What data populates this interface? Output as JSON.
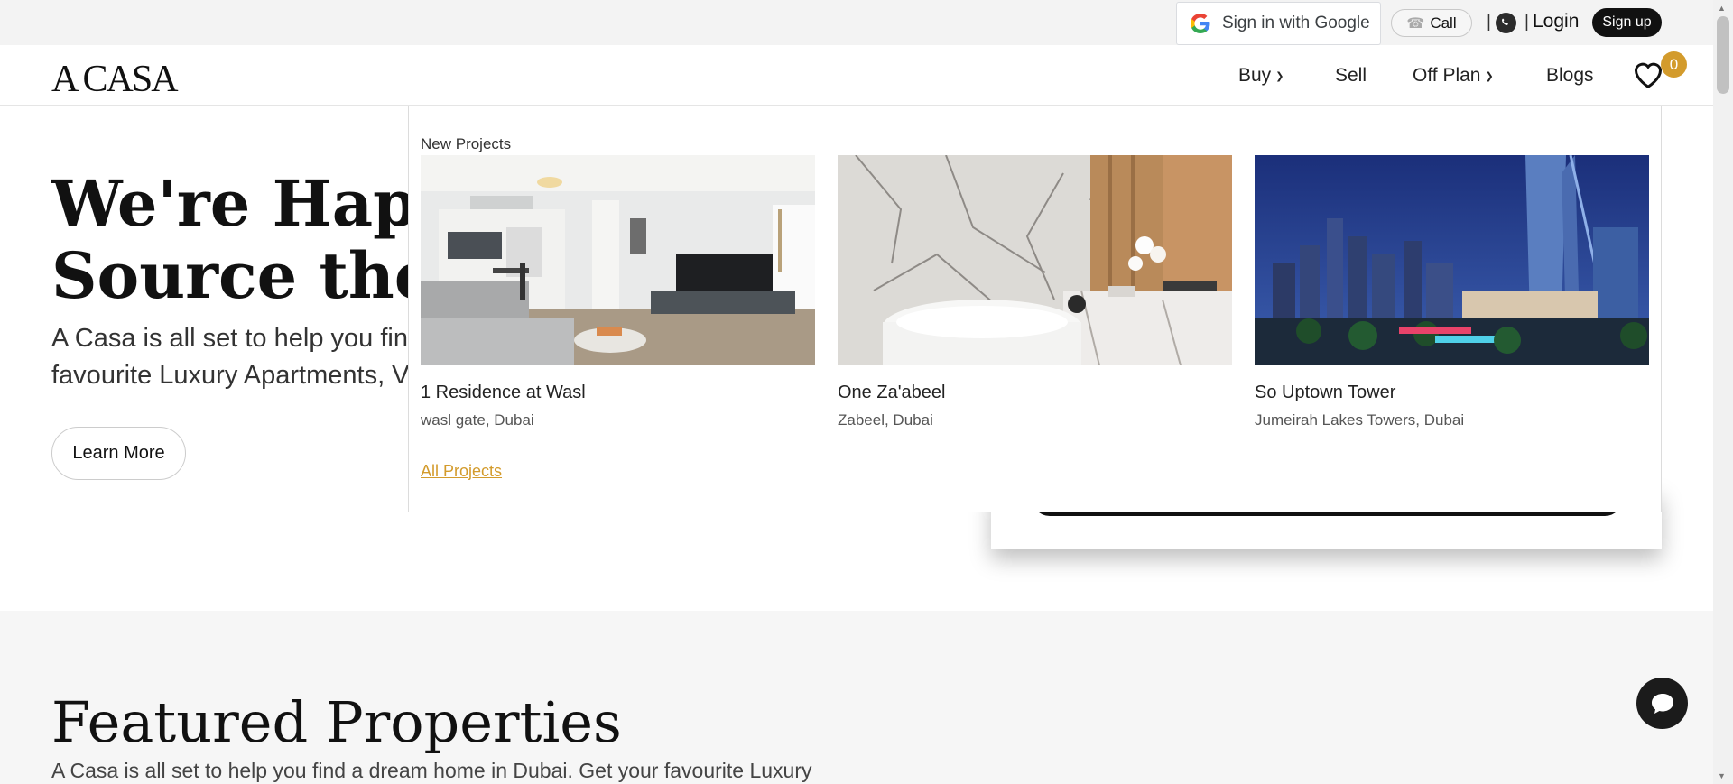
{
  "topbar": {
    "google_label": "Sign in with Google",
    "call_label": "Call",
    "separator": "|",
    "login_label": "Login",
    "signup_label": "Sign up"
  },
  "nav": {
    "logo": "A CASA",
    "items": [
      {
        "label": "Buy",
        "has_dropdown": true
      },
      {
        "label": "Sell",
        "has_dropdown": false
      },
      {
        "label": "Off Plan",
        "has_dropdown": true
      },
      {
        "label": "Blogs",
        "has_dropdown": false
      }
    ],
    "wishlist_count": "0"
  },
  "hero": {
    "title_line1": "We're Happy",
    "title_line2": "Source the Be",
    "text_line1": "A Casa is all set to help you fin",
    "text_line2": "favourite Luxury Apartments, V",
    "button_label": "Learn More"
  },
  "dropdown": {
    "heading": "New Projects",
    "projects": [
      {
        "name": "1 Residence at Wasl",
        "location": "wasl gate, Dubai",
        "image_icon": "apartment-living-room-image"
      },
      {
        "name": "One Za'abeel",
        "location": "Zabeel, Dubai",
        "image_icon": "marble-bathroom-image"
      },
      {
        "name": "So Uptown Tower",
        "location": "Jumeirah Lakes Towers, Dubai",
        "image_icon": "night-skyline-image"
      }
    ],
    "all_projects_label": "All Projects"
  },
  "featured": {
    "title": "Featured Properties",
    "text": "A Casa is all set to help you find a dream home in Dubai. Get your favourite Luxury"
  },
  "colors": {
    "accent": "#d39b2c",
    "dark": "#111111",
    "topbar_bg": "#f3f3f3",
    "section_bg": "#f6f6f6"
  }
}
